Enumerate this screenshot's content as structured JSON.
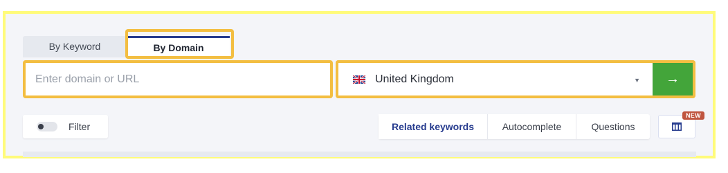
{
  "tabs": [
    {
      "label": "By Keyword",
      "active": false
    },
    {
      "label": "By Domain",
      "active": true
    }
  ],
  "search": {
    "placeholder": "Enter domain or URL",
    "value": "",
    "country": "United Kingdom",
    "flag": "uk-flag-icon",
    "submit_icon": "arrow-right-icon"
  },
  "filter": {
    "label": "Filter",
    "enabled": false
  },
  "modes": [
    {
      "label": "Related keywords",
      "active": true
    },
    {
      "label": "Autocomplete",
      "active": false
    },
    {
      "label": "Questions",
      "active": false
    }
  ],
  "view_button": {
    "icon": "table-columns-icon",
    "badge": "NEW"
  },
  "colors": {
    "highlight": "#f3be41",
    "frame": "#fffb7a",
    "accent": "#263b8e",
    "go_button": "#43a53a",
    "badge": "#c0553f"
  }
}
